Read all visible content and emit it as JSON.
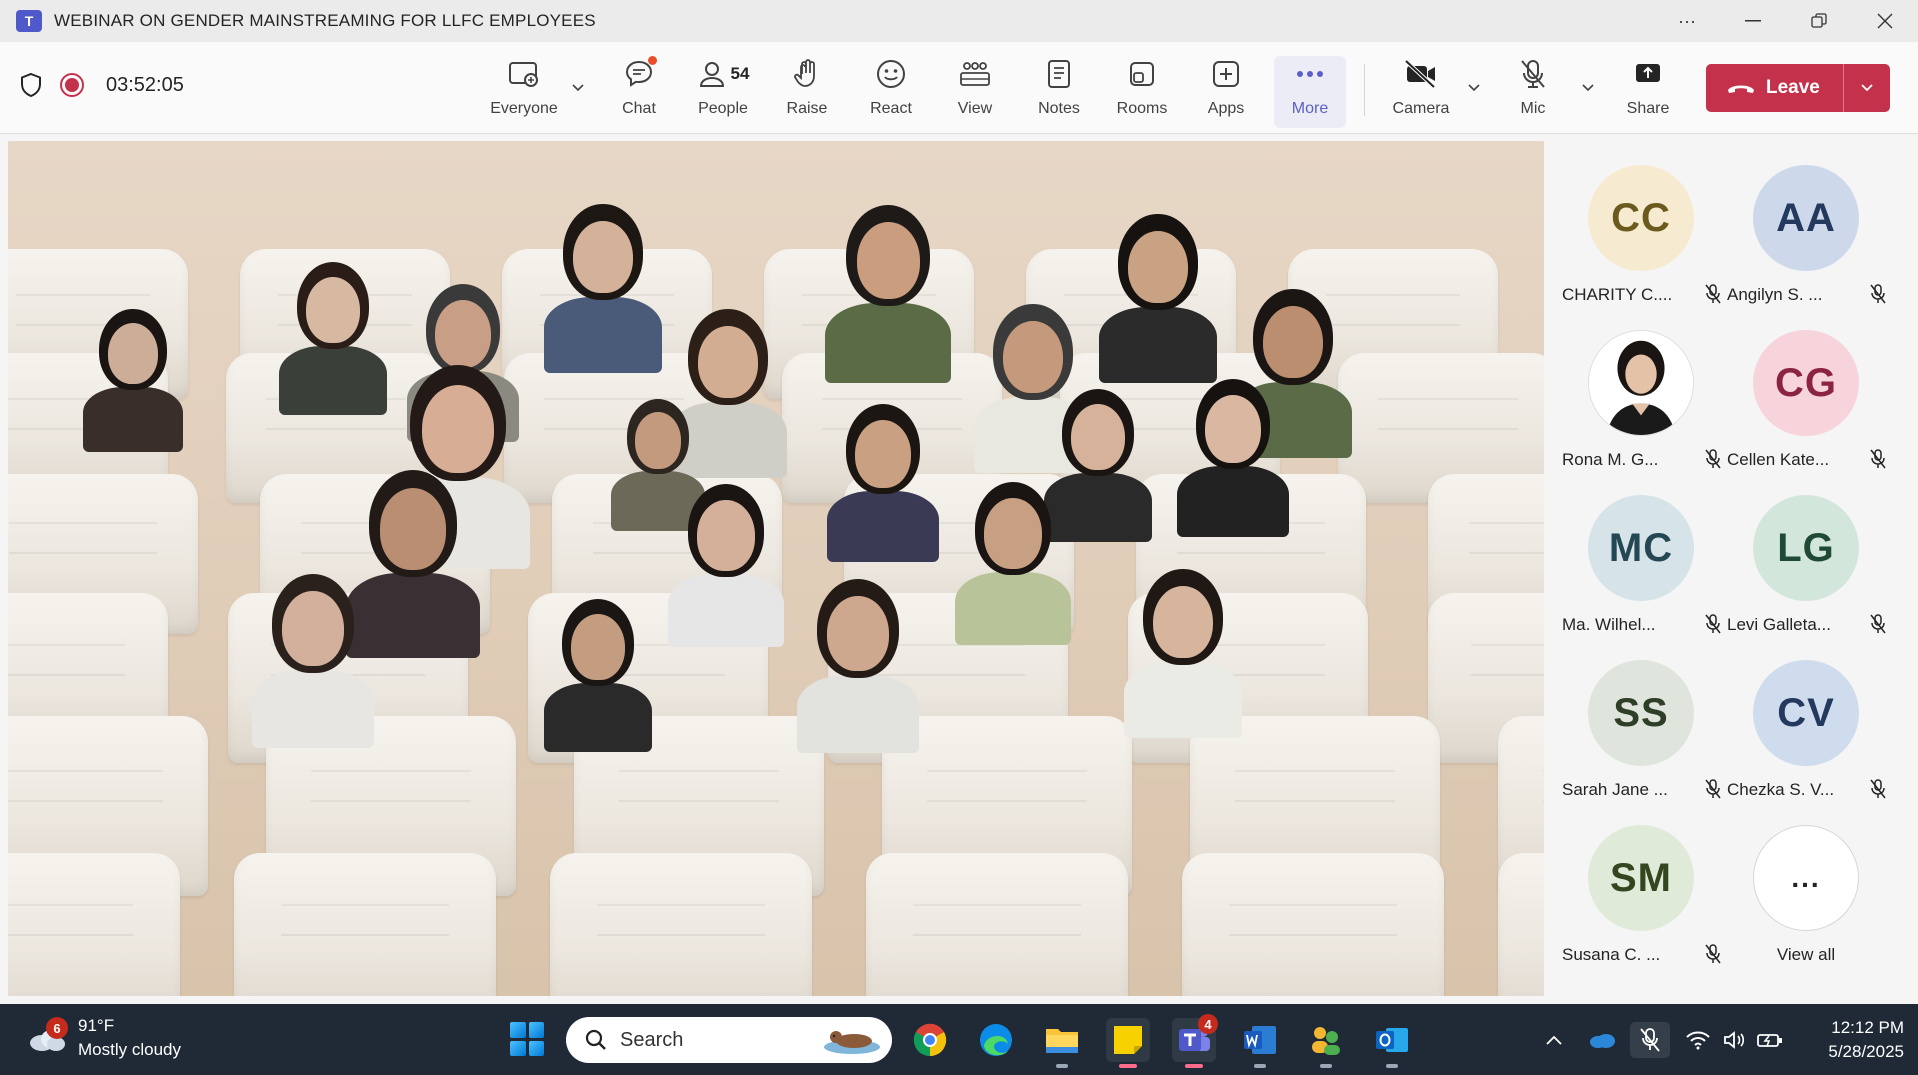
{
  "window": {
    "title": "WEBINAR ON GENDER MAINSTREAMING FOR LLFC EMPLOYEES"
  },
  "meeting": {
    "timer": "03:52:05",
    "toolbar": {
      "everyone": "Everyone",
      "chat": "Chat",
      "people": "People",
      "people_count": "54",
      "raise": "Raise",
      "react": "React",
      "view": "View",
      "notes": "Notes",
      "rooms": "Rooms",
      "apps": "Apps",
      "more": "More",
      "camera": "Camera",
      "mic": "Mic",
      "share": "Share",
      "leave": "Leave"
    }
  },
  "participants": [
    {
      "initials": "CC",
      "name": "CHARITY C....",
      "bg": "#f6ebd0",
      "fg": "#6b5a1e"
    },
    {
      "initials": "AA",
      "name": "Angilyn S. ...",
      "bg": "#cdd9ea",
      "fg": "#233a5e"
    },
    {
      "initials": "",
      "name": "Rona M. G...",
      "bg": "#ffffff",
      "fg": "#242424"
    },
    {
      "initials": "CG",
      "name": "Cellen Kate...",
      "bg": "#f7d3dc",
      "fg": "#8a2442"
    },
    {
      "initials": "MC",
      "name": "Ma. Wilhel...",
      "bg": "#d6e4ea",
      "fg": "#254653"
    },
    {
      "initials": "LG",
      "name": "Levi Galleta...",
      "bg": "#d3e6dc",
      "fg": "#1f4a34"
    },
    {
      "initials": "SS",
      "name": "Sarah Jane ...",
      "bg": "#dfe5dc",
      "fg": "#2f3f27"
    },
    {
      "initials": "CV",
      "name": "Chezka S. V...",
      "bg": "#cfdcee",
      "fg": "#233a5e"
    },
    {
      "initials": "SM",
      "name": "Susana C. ...",
      "bg": "#e0ead8",
      "fg": "#33461f"
    }
  ],
  "view_all": {
    "label": "View all",
    "dots": "..."
  },
  "taskbar": {
    "weather_temp": "91°F",
    "weather_desc": "Mostly cloudy",
    "weather_badge": "6",
    "search_placeholder": "Search",
    "teams_badge": "4",
    "time": "12:12 PM",
    "date": "5/28/2025"
  }
}
